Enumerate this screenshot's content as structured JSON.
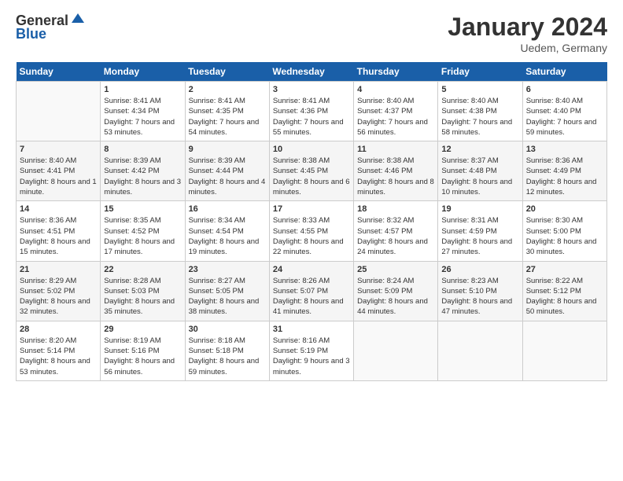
{
  "header": {
    "logo_general": "General",
    "logo_blue": "Blue",
    "month_title": "January 2024",
    "location": "Uedem, Germany"
  },
  "columns": [
    "Sunday",
    "Monday",
    "Tuesday",
    "Wednesday",
    "Thursday",
    "Friday",
    "Saturday"
  ],
  "weeks": [
    [
      {
        "day": "",
        "sunrise": "",
        "sunset": "",
        "daylight": ""
      },
      {
        "day": "1",
        "sunrise": "Sunrise: 8:41 AM",
        "sunset": "Sunset: 4:34 PM",
        "daylight": "Daylight: 7 hours and 53 minutes."
      },
      {
        "day": "2",
        "sunrise": "Sunrise: 8:41 AM",
        "sunset": "Sunset: 4:35 PM",
        "daylight": "Daylight: 7 hours and 54 minutes."
      },
      {
        "day": "3",
        "sunrise": "Sunrise: 8:41 AM",
        "sunset": "Sunset: 4:36 PM",
        "daylight": "Daylight: 7 hours and 55 minutes."
      },
      {
        "day": "4",
        "sunrise": "Sunrise: 8:40 AM",
        "sunset": "Sunset: 4:37 PM",
        "daylight": "Daylight: 7 hours and 56 minutes."
      },
      {
        "day": "5",
        "sunrise": "Sunrise: 8:40 AM",
        "sunset": "Sunset: 4:38 PM",
        "daylight": "Daylight: 7 hours and 58 minutes."
      },
      {
        "day": "6",
        "sunrise": "Sunrise: 8:40 AM",
        "sunset": "Sunset: 4:40 PM",
        "daylight": "Daylight: 7 hours and 59 minutes."
      }
    ],
    [
      {
        "day": "7",
        "sunrise": "Sunrise: 8:40 AM",
        "sunset": "Sunset: 4:41 PM",
        "daylight": "Daylight: 8 hours and 1 minute."
      },
      {
        "day": "8",
        "sunrise": "Sunrise: 8:39 AM",
        "sunset": "Sunset: 4:42 PM",
        "daylight": "Daylight: 8 hours and 3 minutes."
      },
      {
        "day": "9",
        "sunrise": "Sunrise: 8:39 AM",
        "sunset": "Sunset: 4:44 PM",
        "daylight": "Daylight: 8 hours and 4 minutes."
      },
      {
        "day": "10",
        "sunrise": "Sunrise: 8:38 AM",
        "sunset": "Sunset: 4:45 PM",
        "daylight": "Daylight: 8 hours and 6 minutes."
      },
      {
        "day": "11",
        "sunrise": "Sunrise: 8:38 AM",
        "sunset": "Sunset: 4:46 PM",
        "daylight": "Daylight: 8 hours and 8 minutes."
      },
      {
        "day": "12",
        "sunrise": "Sunrise: 8:37 AM",
        "sunset": "Sunset: 4:48 PM",
        "daylight": "Daylight: 8 hours and 10 minutes."
      },
      {
        "day": "13",
        "sunrise": "Sunrise: 8:36 AM",
        "sunset": "Sunset: 4:49 PM",
        "daylight": "Daylight: 8 hours and 12 minutes."
      }
    ],
    [
      {
        "day": "14",
        "sunrise": "Sunrise: 8:36 AM",
        "sunset": "Sunset: 4:51 PM",
        "daylight": "Daylight: 8 hours and 15 minutes."
      },
      {
        "day": "15",
        "sunrise": "Sunrise: 8:35 AM",
        "sunset": "Sunset: 4:52 PM",
        "daylight": "Daylight: 8 hours and 17 minutes."
      },
      {
        "day": "16",
        "sunrise": "Sunrise: 8:34 AM",
        "sunset": "Sunset: 4:54 PM",
        "daylight": "Daylight: 8 hours and 19 minutes."
      },
      {
        "day": "17",
        "sunrise": "Sunrise: 8:33 AM",
        "sunset": "Sunset: 4:55 PM",
        "daylight": "Daylight: 8 hours and 22 minutes."
      },
      {
        "day": "18",
        "sunrise": "Sunrise: 8:32 AM",
        "sunset": "Sunset: 4:57 PM",
        "daylight": "Daylight: 8 hours and 24 minutes."
      },
      {
        "day": "19",
        "sunrise": "Sunrise: 8:31 AM",
        "sunset": "Sunset: 4:59 PM",
        "daylight": "Daylight: 8 hours and 27 minutes."
      },
      {
        "day": "20",
        "sunrise": "Sunrise: 8:30 AM",
        "sunset": "Sunset: 5:00 PM",
        "daylight": "Daylight: 8 hours and 30 minutes."
      }
    ],
    [
      {
        "day": "21",
        "sunrise": "Sunrise: 8:29 AM",
        "sunset": "Sunset: 5:02 PM",
        "daylight": "Daylight: 8 hours and 32 minutes."
      },
      {
        "day": "22",
        "sunrise": "Sunrise: 8:28 AM",
        "sunset": "Sunset: 5:03 PM",
        "daylight": "Daylight: 8 hours and 35 minutes."
      },
      {
        "day": "23",
        "sunrise": "Sunrise: 8:27 AM",
        "sunset": "Sunset: 5:05 PM",
        "daylight": "Daylight: 8 hours and 38 minutes."
      },
      {
        "day": "24",
        "sunrise": "Sunrise: 8:26 AM",
        "sunset": "Sunset: 5:07 PM",
        "daylight": "Daylight: 8 hours and 41 minutes."
      },
      {
        "day": "25",
        "sunrise": "Sunrise: 8:24 AM",
        "sunset": "Sunset: 5:09 PM",
        "daylight": "Daylight: 8 hours and 44 minutes."
      },
      {
        "day": "26",
        "sunrise": "Sunrise: 8:23 AM",
        "sunset": "Sunset: 5:10 PM",
        "daylight": "Daylight: 8 hours and 47 minutes."
      },
      {
        "day": "27",
        "sunrise": "Sunrise: 8:22 AM",
        "sunset": "Sunset: 5:12 PM",
        "daylight": "Daylight: 8 hours and 50 minutes."
      }
    ],
    [
      {
        "day": "28",
        "sunrise": "Sunrise: 8:20 AM",
        "sunset": "Sunset: 5:14 PM",
        "daylight": "Daylight: 8 hours and 53 minutes."
      },
      {
        "day": "29",
        "sunrise": "Sunrise: 8:19 AM",
        "sunset": "Sunset: 5:16 PM",
        "daylight": "Daylight: 8 hours and 56 minutes."
      },
      {
        "day": "30",
        "sunrise": "Sunrise: 8:18 AM",
        "sunset": "Sunset: 5:18 PM",
        "daylight": "Daylight: 8 hours and 59 minutes."
      },
      {
        "day": "31",
        "sunrise": "Sunrise: 8:16 AM",
        "sunset": "Sunset: 5:19 PM",
        "daylight": "Daylight: 9 hours and 3 minutes."
      },
      {
        "day": "",
        "sunrise": "",
        "sunset": "",
        "daylight": ""
      },
      {
        "day": "",
        "sunrise": "",
        "sunset": "",
        "daylight": ""
      },
      {
        "day": "",
        "sunrise": "",
        "sunset": "",
        "daylight": ""
      }
    ]
  ]
}
